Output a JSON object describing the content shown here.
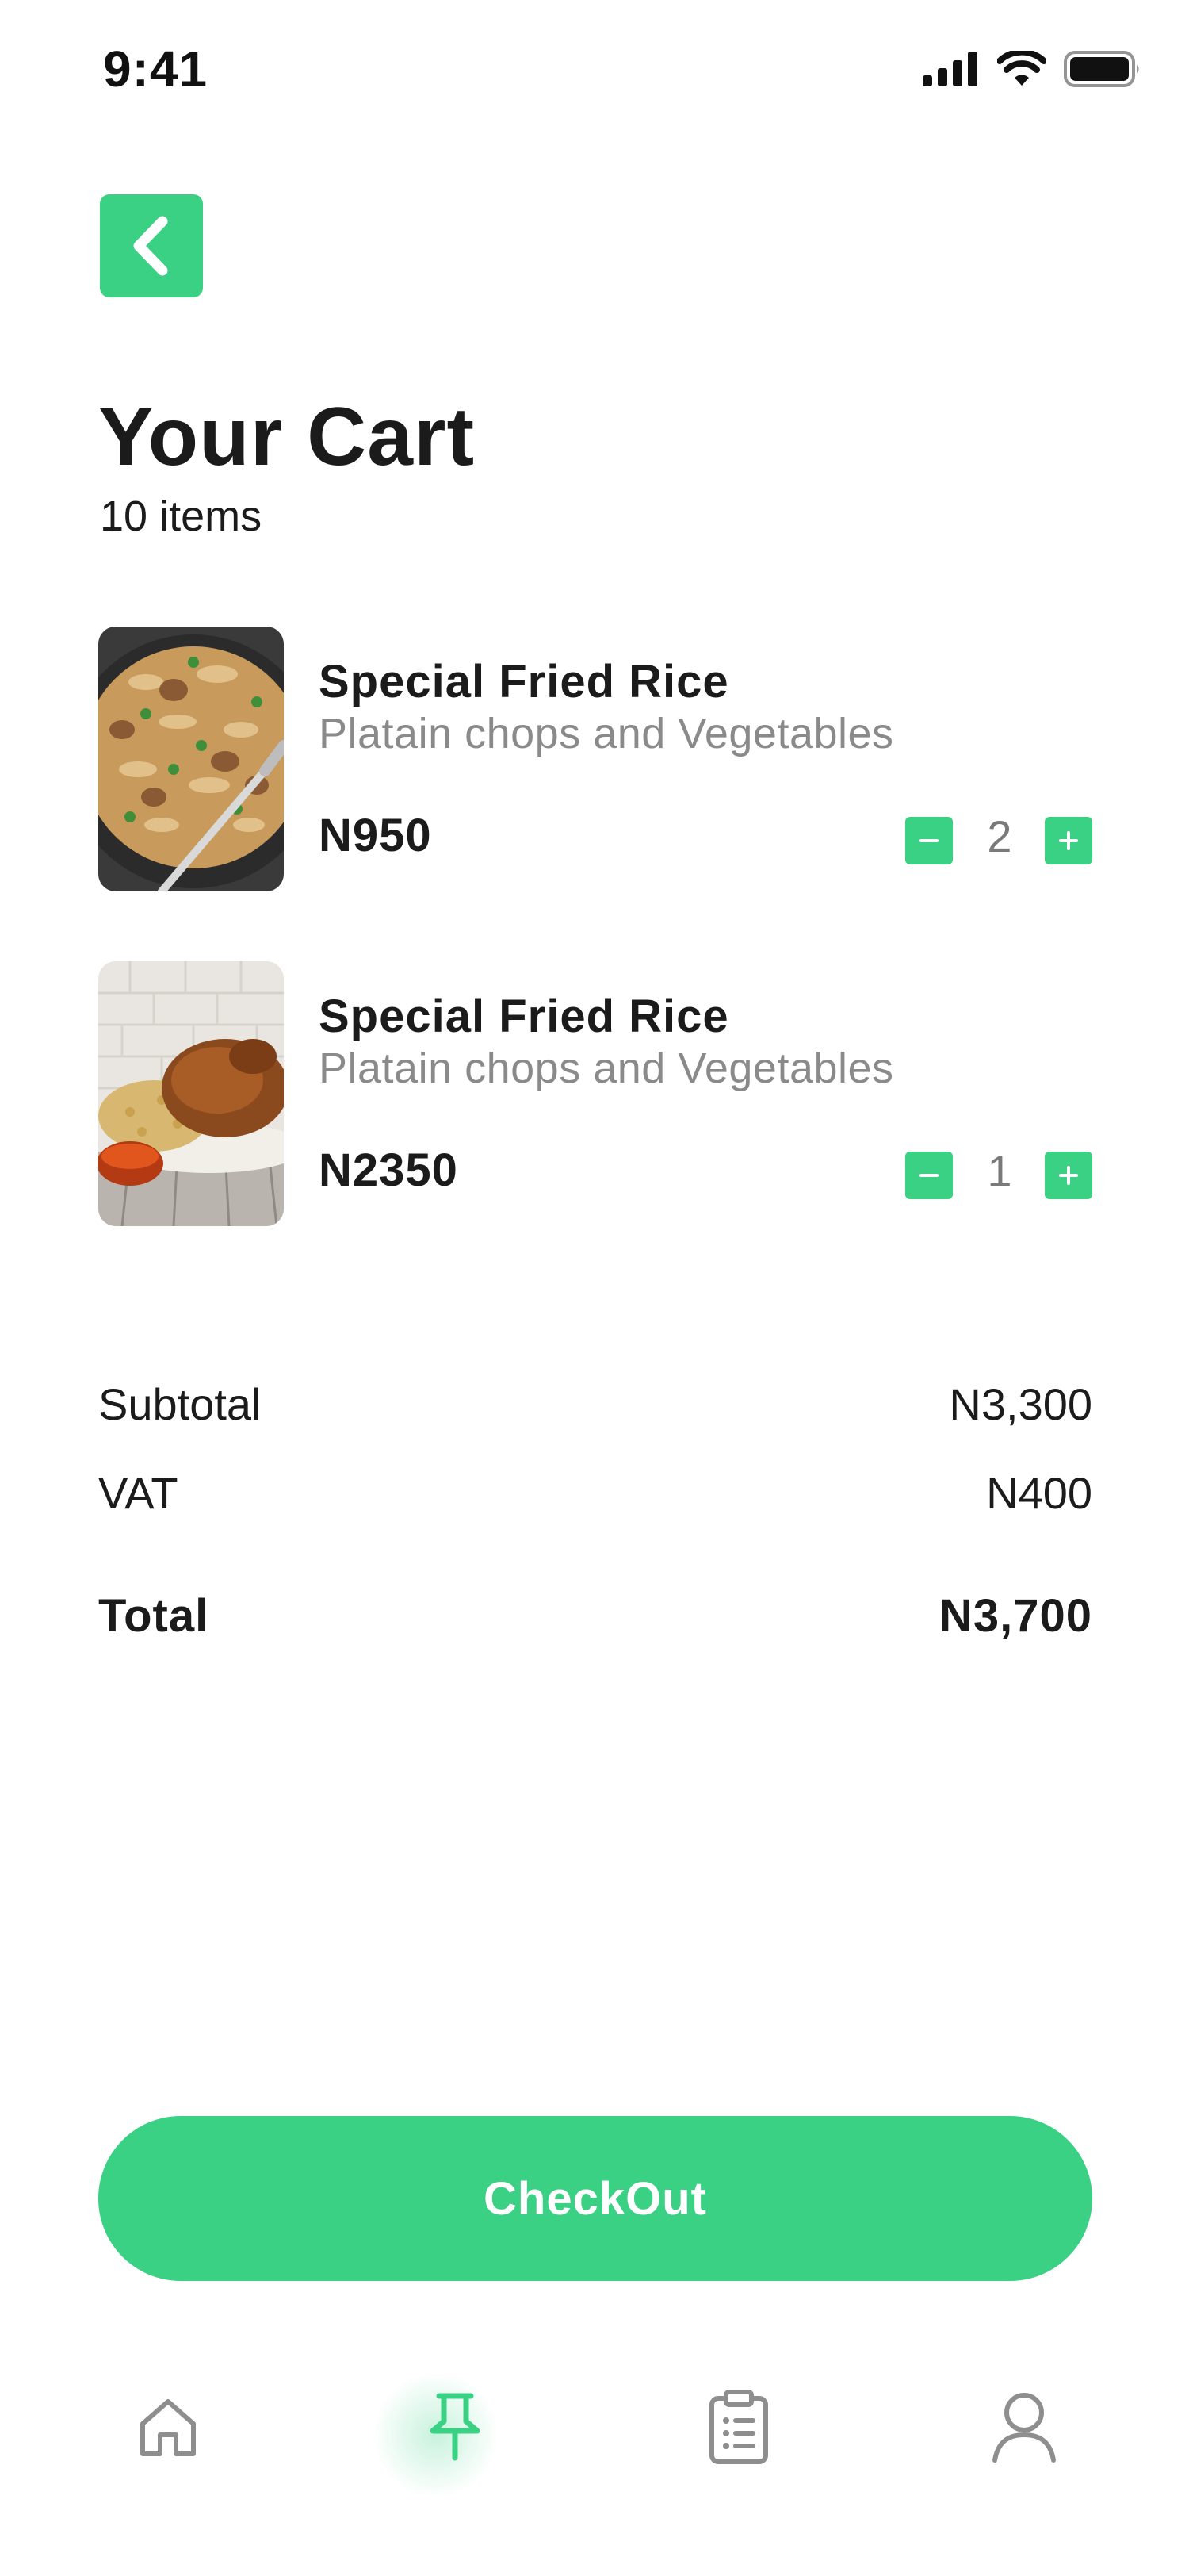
{
  "status_bar": {
    "time": "9:41",
    "icons": [
      "cellular-signal-icon",
      "wifi-icon",
      "battery-icon"
    ]
  },
  "header": {
    "back_icon": "chevron-left-icon",
    "title": "Your Cart",
    "item_count": "10 items"
  },
  "cart": {
    "items": [
      {
        "name": "Special Fried Rice",
        "description": "Platain chops and Vegetables",
        "price": "N950",
        "quantity": "2",
        "image": "fried-rice-photo"
      },
      {
        "name": "Special Fried Rice",
        "description": "Platain chops and Vegetables",
        "price": "N2350",
        "quantity": "1",
        "image": "rice-and-chicken-photo"
      }
    ]
  },
  "summary": {
    "subtotal_label": "Subtotal",
    "subtotal_value": "N3,300",
    "vat_label": "VAT",
    "vat_value": "N400",
    "total_label": "Total",
    "total_value": "N3,700"
  },
  "checkout": {
    "label": "CheckOut"
  },
  "nav": {
    "items": [
      {
        "icon": "home-icon",
        "active": false
      },
      {
        "icon": "pin-icon",
        "active": true
      },
      {
        "icon": "clipboard-list-icon",
        "active": false
      },
      {
        "icon": "user-icon",
        "active": false
      }
    ]
  },
  "colors": {
    "accent": "#3ad184",
    "text": "#1b1b1b",
    "muted": "#8a8a8a",
    "icon_inactive": "#8e8e8e"
  }
}
